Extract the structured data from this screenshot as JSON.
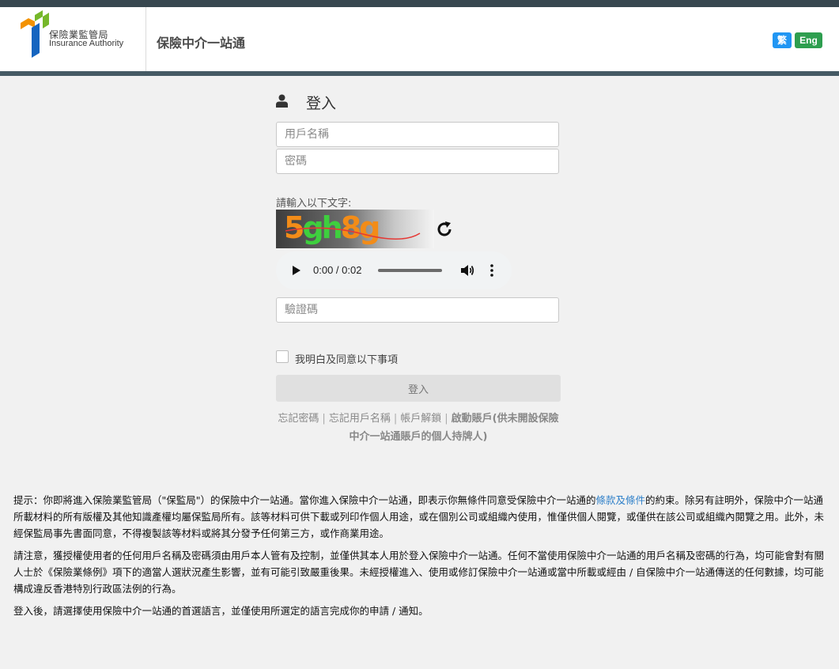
{
  "header": {
    "logo_zh": "保險業監管局",
    "logo_en": "Insurance Authority",
    "site_title": "保險中介一站通",
    "lang_zh": "繁",
    "lang_en": "Eng",
    "colors": {
      "lang_zh": "#2196f3",
      "lang_en": "#2e9e4f",
      "bar": "#455a64"
    }
  },
  "login": {
    "icon": "user-icon",
    "title": "登入",
    "username_placeholder": "用戶名稱",
    "password_placeholder": "密碼",
    "captcha_label": "請輸入以下文字:",
    "captcha_text": "5gh8g",
    "refresh_icon": "refresh-icon",
    "audio_time": "0:00 / 0:02",
    "captcha_placeholder": "驗證碼",
    "agree_label": "我明白及同意以下事項",
    "submit_label": "登入"
  },
  "links": {
    "forgot_password": "忘記密碼",
    "forgot_username": "忘記用戶名稱",
    "unlock_account": "帳戶解鎖",
    "activate_account": "啟動賬戶(供未開設保險中介一站通賬戶的個人持牌人)",
    "separator": "|"
  },
  "notice": {
    "p1_before": "提示：你即將進入保險業監管局（\"保監局\"）的保險中介一站通。當你進入保險中介一站通，即表示你無條件同意受保險中介一站通的",
    "p1_link": "條款及條件",
    "p1_after": "的約束。除另有註明外，保險中介一站通所載材料的所有版權及其他知識產權均屬保監局所有。該等材料可供下載或列印作個人用途，或在個別公司或組織內使用，惟僅供個人閱覽，或僅供在該公司或組織內閱覽之用。此外，未經保監局事先書面同意，不得複製該等材料或將其分發予任何第三方，或作商業用途。",
    "p2": "請注意，獲授權使用者的任何用戶名稱及密碼須由用戶本人管有及控制，並僅供其本人用於登入保險中介一站通。任何不當使用保險中介一站通的用戶名稱及密碼的行為，均可能會對有關人士於《保險業條例》項下的適當人選狀況產生影響，並有可能引致嚴重後果。未經授權進入、使用或修訂保險中介一站通或當中所載或經由 / 自保險中介一站通傳送的任何數據，均可能構成違反香港特別行政區法例的行為。",
    "p3": "登入後，請選擇使用保險中介一站通的首選語言，並僅使用所選定的語言完成你的申請 / 通知。"
  }
}
